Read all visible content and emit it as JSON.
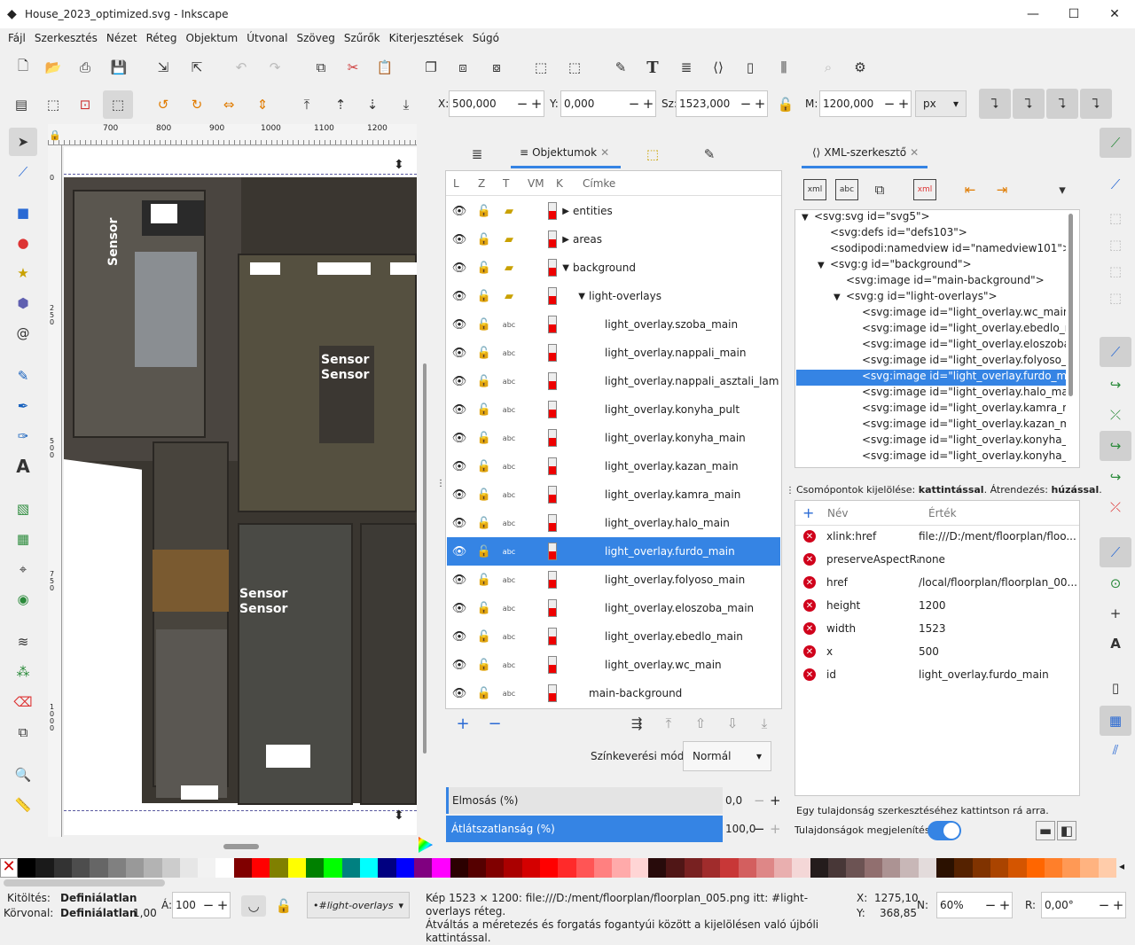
{
  "window": {
    "title": "House_2023_optimized.svg - Inkscape",
    "min": "—",
    "max": "☐",
    "close": "✕"
  },
  "menu": [
    "Fájl",
    "Szerkesztés",
    "Nézet",
    "Réteg",
    "Objektum",
    "Útvonal",
    "Szöveg",
    "Szűrők",
    "Kiterjesztések",
    "Súgó"
  ],
  "toolbar": {
    "x_label": "X:",
    "x_value": "500,000",
    "y_label": "Y:",
    "y_value": "0,000",
    "w_label": "Sz:",
    "w_value": "1523,000",
    "h_label": "M:",
    "h_value": "1200,000",
    "unit": "px"
  },
  "ruler": {
    "marks": [
      "700",
      "800",
      "900",
      "1000",
      "1100",
      "1200"
    ],
    "vmarks": [
      "0",
      "250",
      "500",
      "750",
      "1000"
    ]
  },
  "canvas": {
    "labels": [
      "Sensor",
      "Sensor\nSensor",
      "Sensor\nSensor"
    ]
  },
  "objects": {
    "tabs": [
      "Objektumok"
    ],
    "headers": [
      "L",
      "Z",
      "T",
      "VM",
      "K",
      "Címke"
    ],
    "rows": [
      {
        "label": "entities",
        "indent": 0,
        "arrow": "▶",
        "type": "layer"
      },
      {
        "label": "areas",
        "indent": 0,
        "arrow": "▶",
        "type": "layer"
      },
      {
        "label": "background",
        "indent": 0,
        "arrow": "▼",
        "type": "layer"
      },
      {
        "label": "light-overlays",
        "indent": 1,
        "arrow": "▼",
        "type": "layer"
      },
      {
        "label": "light_overlay.szoba_main",
        "indent": 2,
        "arrow": "",
        "type": "abc"
      },
      {
        "label": "light_overlay.nappali_main",
        "indent": 2,
        "arrow": "",
        "type": "abc"
      },
      {
        "label": "light_overlay.nappali_asztali_lam",
        "indent": 2,
        "arrow": "",
        "type": "abc"
      },
      {
        "label": "light_overlay.konyha_pult",
        "indent": 2,
        "arrow": "",
        "type": "abc"
      },
      {
        "label": "light_overlay.konyha_main",
        "indent": 2,
        "arrow": "",
        "type": "abc"
      },
      {
        "label": "light_overlay.kazan_main",
        "indent": 2,
        "arrow": "",
        "type": "abc"
      },
      {
        "label": "light_overlay.kamra_main",
        "indent": 2,
        "arrow": "",
        "type": "abc"
      },
      {
        "label": "light_overlay.halo_main",
        "indent": 2,
        "arrow": "",
        "type": "abc"
      },
      {
        "label": "light_overlay.furdo_main",
        "indent": 2,
        "arrow": "",
        "type": "abc",
        "selected": true
      },
      {
        "label": "light_overlay.folyoso_main",
        "indent": 2,
        "arrow": "",
        "type": "abc"
      },
      {
        "label": "light_overlay.eloszoba_main",
        "indent": 2,
        "arrow": "",
        "type": "abc"
      },
      {
        "label": "light_overlay.ebedlo_main",
        "indent": 2,
        "arrow": "",
        "type": "abc"
      },
      {
        "label": "light_overlay.wc_main",
        "indent": 2,
        "arrow": "",
        "type": "abc"
      },
      {
        "label": "main-background",
        "indent": 1,
        "arrow": "",
        "type": "abc"
      }
    ],
    "blend_label": "Színkeverési mód:",
    "blend_value": "Normál",
    "blur_label": "Elmosás (%)",
    "blur_value": "0,0",
    "opacity_label": "Átlátszatlanság (%)",
    "opacity_value": "100,0"
  },
  "xml": {
    "tab": "XML-szerkesztő",
    "nodes": [
      {
        "text": "<svg:svg id=\"svg5\">",
        "indent": 0,
        "arrow": "▼"
      },
      {
        "text": "<svg:defs id=\"defs103\">",
        "indent": 1,
        "arrow": ""
      },
      {
        "text": "<sodipodi:namedview id=\"namedview101\">",
        "indent": 1,
        "arrow": ""
      },
      {
        "text": "<svg:g id=\"background\">",
        "indent": 1,
        "arrow": "▼"
      },
      {
        "text": "<svg:image id=\"main-background\">",
        "indent": 2,
        "arrow": ""
      },
      {
        "text": "<svg:g id=\"light-overlays\">",
        "indent": 2,
        "arrow": "▼"
      },
      {
        "text": "<svg:image id=\"light_overlay.wc_main\">",
        "indent": 3,
        "arrow": ""
      },
      {
        "text": "<svg:image id=\"light_overlay.ebedlo_main\">",
        "indent": 3,
        "arrow": ""
      },
      {
        "text": "<svg:image id=\"light_overlay.eloszoba_main\">",
        "indent": 3,
        "arrow": ""
      },
      {
        "text": "<svg:image id=\"light_overlay.folyoso_main\">",
        "indent": 3,
        "arrow": ""
      },
      {
        "text": "<svg:image id=\"light_overlay.furdo_main\">",
        "indent": 3,
        "arrow": "",
        "selected": true
      },
      {
        "text": "<svg:image id=\"light_overlay.halo_main\">",
        "indent": 3,
        "arrow": ""
      },
      {
        "text": "<svg:image id=\"light_overlay.kamra_main\">",
        "indent": 3,
        "arrow": ""
      },
      {
        "text": "<svg:image id=\"light_overlay.kazan_main\">",
        "indent": 3,
        "arrow": ""
      },
      {
        "text": "<svg:image id=\"light_overlay.konyha_main\">",
        "indent": 3,
        "arrow": ""
      },
      {
        "text": "<svg:image id=\"light_overlay.konyha_pult\">",
        "indent": 3,
        "arrow": ""
      }
    ],
    "hint_a": "Csomópontok kijelölése: ",
    "hint_b": "kattintással",
    "hint_c": ". Átrendezés: ",
    "hint_d": "húzással",
    "attr_headers": [
      "Név",
      "Érték"
    ],
    "attrs": [
      {
        "name": "xlink:href",
        "value": "file:///D:/ment/floorplan/floo..."
      },
      {
        "name": "preserveAspectRatio",
        "value": "none"
      },
      {
        "name": "href",
        "value": "/local/floorplan/floorplan_00..."
      },
      {
        "name": "height",
        "value": "1200"
      },
      {
        "name": "width",
        "value": "1523"
      },
      {
        "name": "x",
        "value": "500"
      },
      {
        "name": "id",
        "value": "light_overlay.furdo_main"
      }
    ],
    "edit_hint": "Egy tulajdonság szerkesztéséhez kattintson rá arra.",
    "show_attrs": "Tulajdonságok megjelenítése"
  },
  "status": {
    "fill_label": "Kitöltés:",
    "fill_value": "Definiálatlan",
    "stroke_label": "Körvonal:",
    "stroke_value": "Definiálatlan",
    "stroke_width": "1,00",
    "opacity_label": "Á:",
    "opacity_value": "100",
    "layer": "•#light-overlays",
    "msg1": "Kép 1523 × 1200: file:///D:/ment/floorplan/floorplan_005.png itt: #light-overlays réteg.",
    "msg2": "Átváltás a méretezés és forgatás fogantyúi között a kijelölésen való újbóli kattintással.",
    "x_label": "X:",
    "x_value": "1275,10",
    "y_label": "Y:",
    "y_value": "368,85",
    "zoom_label": "N:",
    "zoom_value": "60%",
    "rot_label": "R:",
    "rot_value": "0,00°"
  },
  "palette": [
    "#000000",
    "#1a1a1a",
    "#333333",
    "#4d4d4d",
    "#666666",
    "#808080",
    "#999999",
    "#b3b3b3",
    "#cccccc",
    "#e6e6e6",
    "#f2f2f2",
    "#ffffff",
    "#800000",
    "#ff0000",
    "#808000",
    "#ffff00",
    "#008000",
    "#00ff00",
    "#008080",
    "#00ffff",
    "#000080",
    "#0000ff",
    "#800080",
    "#ff00ff",
    "#2b0000",
    "#550000",
    "#800000",
    "#aa0000",
    "#d40000",
    "#ff0000",
    "#ff2a2a",
    "#ff5555",
    "#ff8080",
    "#ffaaaa",
    "#ffd5d5",
    "#280b0b",
    "#501616",
    "#782121",
    "#a02c2c",
    "#c83737",
    "#d35f5f",
    "#de8787",
    "#e9afaf",
    "#f4d7d7",
    "#241c1c",
    "#483737",
    "#6c5353",
    "#916f6f",
    "#ac9393",
    "#c8b7b7",
    "#e3dbdb",
    "#2b1100",
    "#552200",
    "#803300",
    "#aa4400",
    "#d45500",
    "#ff6600",
    "#ff7f2a",
    "#ff9955",
    "#ffb380",
    "#ffccaa"
  ]
}
